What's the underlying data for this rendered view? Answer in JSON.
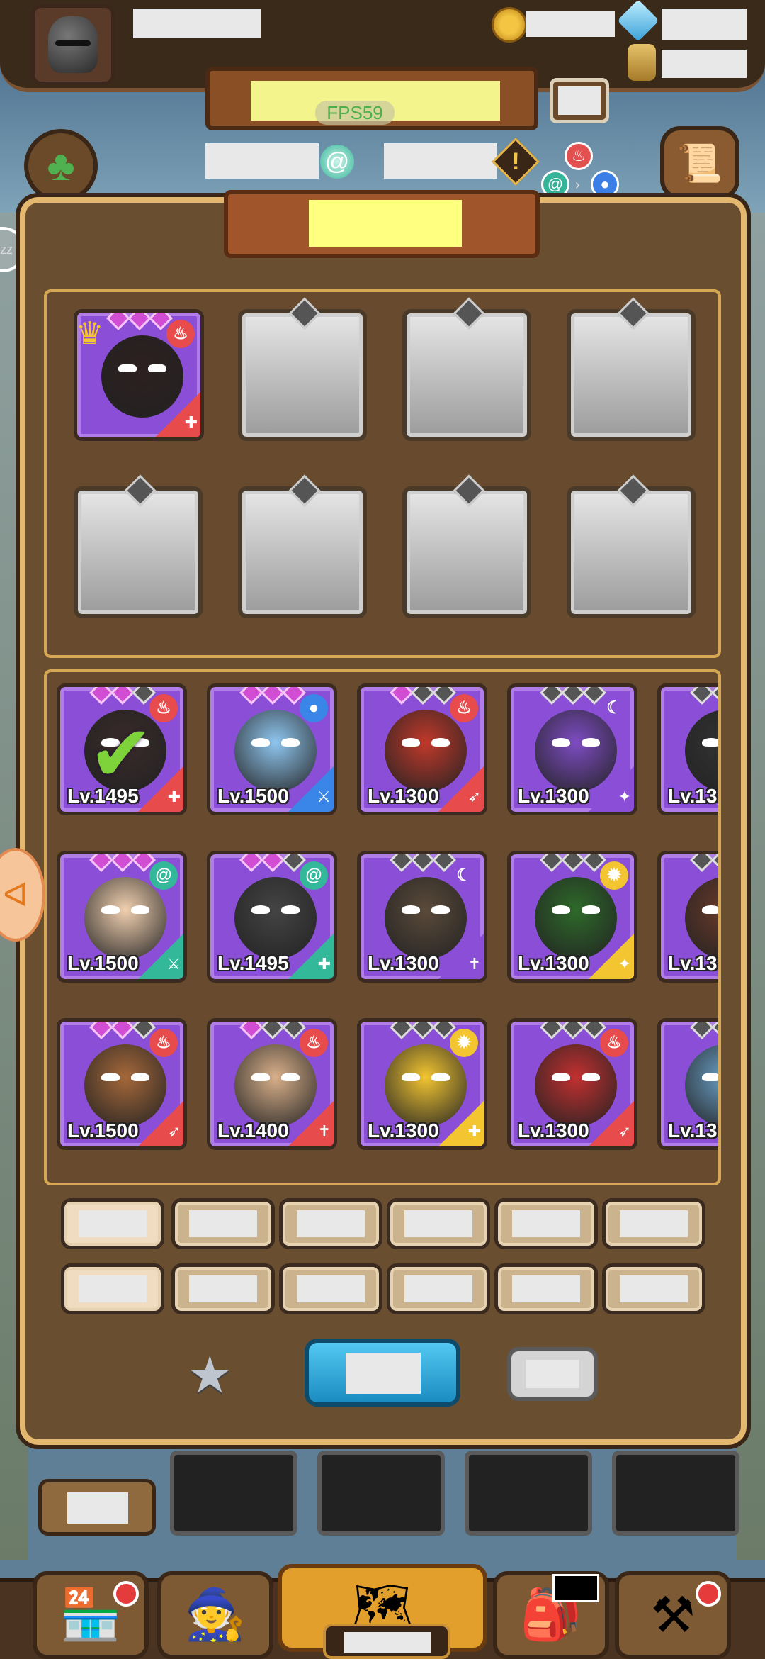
{
  "header": {
    "username": "",
    "gold": "",
    "gems": "",
    "potion": "",
    "fps": "FPS59",
    "banner_title": "",
    "top_button": "",
    "stat_left": "",
    "stat_right": "",
    "warning_symbol": "!"
  },
  "panel": {
    "title": "",
    "party_slots": [
      {
        "filled": true,
        "leader": true,
        "element": "fire",
        "class": "tank"
      },
      {
        "filled": false
      },
      {
        "filled": false
      },
      {
        "filled": false
      },
      {
        "filled": false
      },
      {
        "filled": false
      },
      {
        "filled": false
      },
      {
        "filled": false
      }
    ],
    "heroes": [
      {
        "level": "Lv.1495",
        "element": "fire",
        "class": "tank",
        "selected": true,
        "stars": 2,
        "color": "#3a2a2a"
      },
      {
        "level": "Lv.1500",
        "element": "water",
        "class": "melee",
        "selected": false,
        "stars": 3,
        "color": "#8fc6ef"
      },
      {
        "level": "Lv.1300",
        "element": "fire",
        "class": "ranged",
        "selected": false,
        "stars": 1,
        "color": "#c0392b"
      },
      {
        "level": "Lv.1300",
        "element": "dark",
        "class": "mage",
        "selected": false,
        "stars": 0,
        "color": "#7d4cc2"
      },
      {
        "level": "Lv.13",
        "element": "fire",
        "class": "melee",
        "selected": false,
        "stars": 0,
        "color": "#333"
      },
      {
        "level": "Lv.1500",
        "element": "wind",
        "class": "melee",
        "selected": false,
        "stars": 3,
        "color": "#f1d0b0"
      },
      {
        "level": "Lv.1495",
        "element": "wind",
        "class": "tank",
        "selected": false,
        "stars": 2,
        "color": "#444"
      },
      {
        "level": "Lv.1300",
        "element": "dark",
        "class": "support",
        "selected": false,
        "stars": 0,
        "color": "#5a4a3a"
      },
      {
        "level": "Lv.1300",
        "element": "light",
        "class": "mage",
        "selected": false,
        "stars": 0,
        "color": "#2e6a2a"
      },
      {
        "level": "Lv.13",
        "element": "fire",
        "class": "melee",
        "selected": false,
        "stars": 0,
        "color": "#6a3a2a"
      },
      {
        "level": "Lv.1500",
        "element": "fire",
        "class": "ranged",
        "selected": false,
        "stars": 2,
        "color": "#a5683a"
      },
      {
        "level": "Lv.1400",
        "element": "fire",
        "class": "support",
        "selected": false,
        "stars": 1,
        "color": "#d9b08a"
      },
      {
        "level": "Lv.1300",
        "element": "light",
        "class": "tank",
        "selected": false,
        "stars": 0,
        "color": "#f2c531"
      },
      {
        "level": "Lv.1300",
        "element": "fire",
        "class": "ranged",
        "selected": false,
        "stars": 0,
        "color": "#c23030"
      },
      {
        "level": "Lv.13",
        "element": "water",
        "class": "melee",
        "selected": false,
        "stars": 0,
        "color": "#6aa0c8"
      }
    ],
    "filters_row1": [
      "",
      "",
      "",
      "",
      "",
      ""
    ],
    "filters_row2": [
      "",
      "",
      "",
      "",
      "",
      ""
    ],
    "confirm_label": "",
    "cancel_label": ""
  },
  "bottom": {
    "left_label": "",
    "nav_active_label": "",
    "nav_icons": [
      "shop-icon",
      "hero-icon",
      "adventure-map-icon",
      "inventory-bag-icon",
      "crafting-hammer-icon"
    ]
  },
  "colors": {
    "fire": "#e84b4b",
    "water": "#3a86e8",
    "wind": "#34b89a",
    "dark": "#8a4fd6",
    "light": "#f2c531",
    "accent_blue": "#2ea8dc",
    "panel_gold": "#e5b870"
  }
}
